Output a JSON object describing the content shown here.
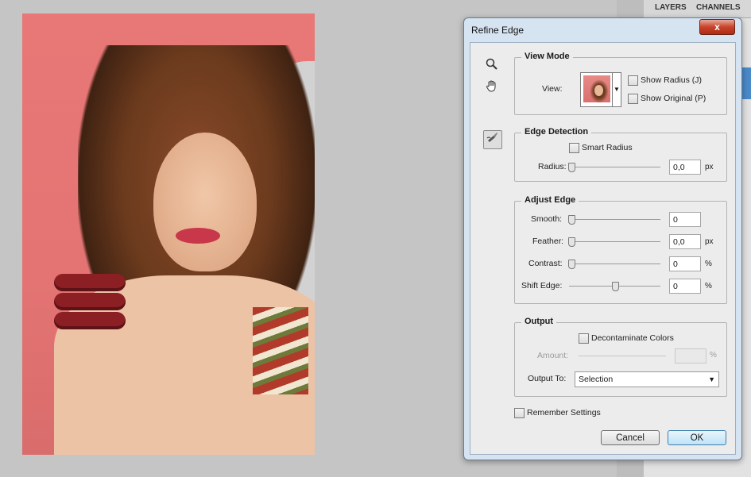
{
  "panel": {
    "tab_layers": "LAYERS",
    "tab_channels": "CHANNELS"
  },
  "dialog": {
    "title": "Refine Edge",
    "close_label": "x",
    "tools": [
      "zoom-icon",
      "hand-icon",
      "refine-radius-brush-icon"
    ],
    "view_mode": {
      "legend": "View Mode",
      "view_label": "View:",
      "show_radius": "Show Radius (J)",
      "show_original": "Show Original (P)"
    },
    "edge_detection": {
      "legend": "Edge Detection",
      "smart_radius": "Smart Radius",
      "radius_label": "Radius:",
      "radius_value": "0,0",
      "radius_unit": "px"
    },
    "adjust_edge": {
      "legend": "Adjust Edge",
      "smooth_label": "Smooth:",
      "smooth_value": "0",
      "feather_label": "Feather:",
      "feather_value": "0,0",
      "feather_unit": "px",
      "contrast_label": "Contrast:",
      "contrast_value": "0",
      "contrast_unit": "%",
      "shift_label": "Shift Edge:",
      "shift_value": "0",
      "shift_unit": "%"
    },
    "output": {
      "legend": "Output",
      "decontaminate": "Decontaminate Colors",
      "amount_label": "Amount:",
      "amount_unit": "%",
      "output_to_label": "Output To:",
      "output_to_value": "Selection"
    },
    "remember": "Remember Settings",
    "cancel": "Cancel",
    "ok": "OK"
  }
}
